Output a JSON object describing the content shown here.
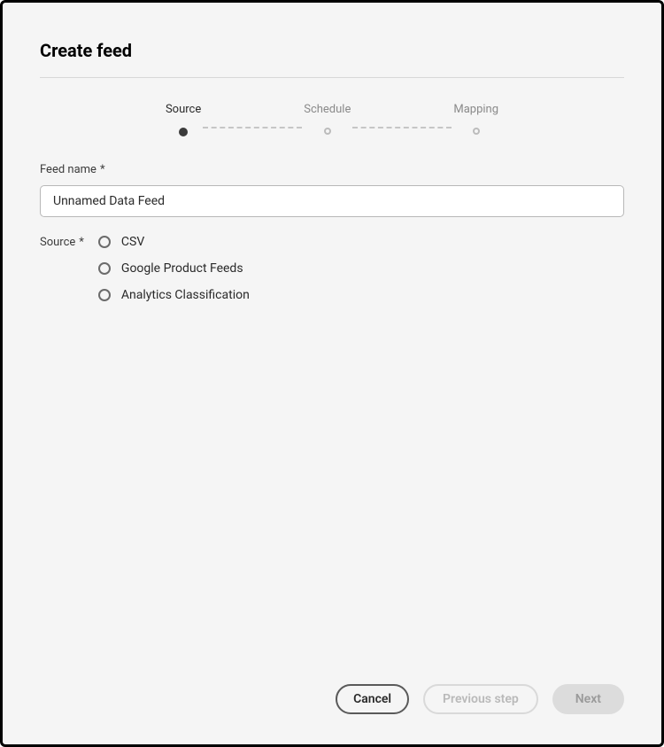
{
  "header": {
    "title": "Create feed"
  },
  "stepper": {
    "steps": [
      {
        "label": "Source",
        "active": true
      },
      {
        "label": "Schedule",
        "active": false
      },
      {
        "label": "Mapping",
        "active": false
      }
    ]
  },
  "fields": {
    "feed_name": {
      "label": "Feed name",
      "required_mark": "*",
      "value": "Unnamed Data Feed"
    },
    "source": {
      "label": "Source",
      "required_mark": "*",
      "options": [
        {
          "label": "CSV"
        },
        {
          "label": "Google Product Feeds"
        },
        {
          "label": "Analytics Classification"
        }
      ]
    }
  },
  "footer": {
    "cancel": "Cancel",
    "previous": "Previous step",
    "next": "Next"
  }
}
